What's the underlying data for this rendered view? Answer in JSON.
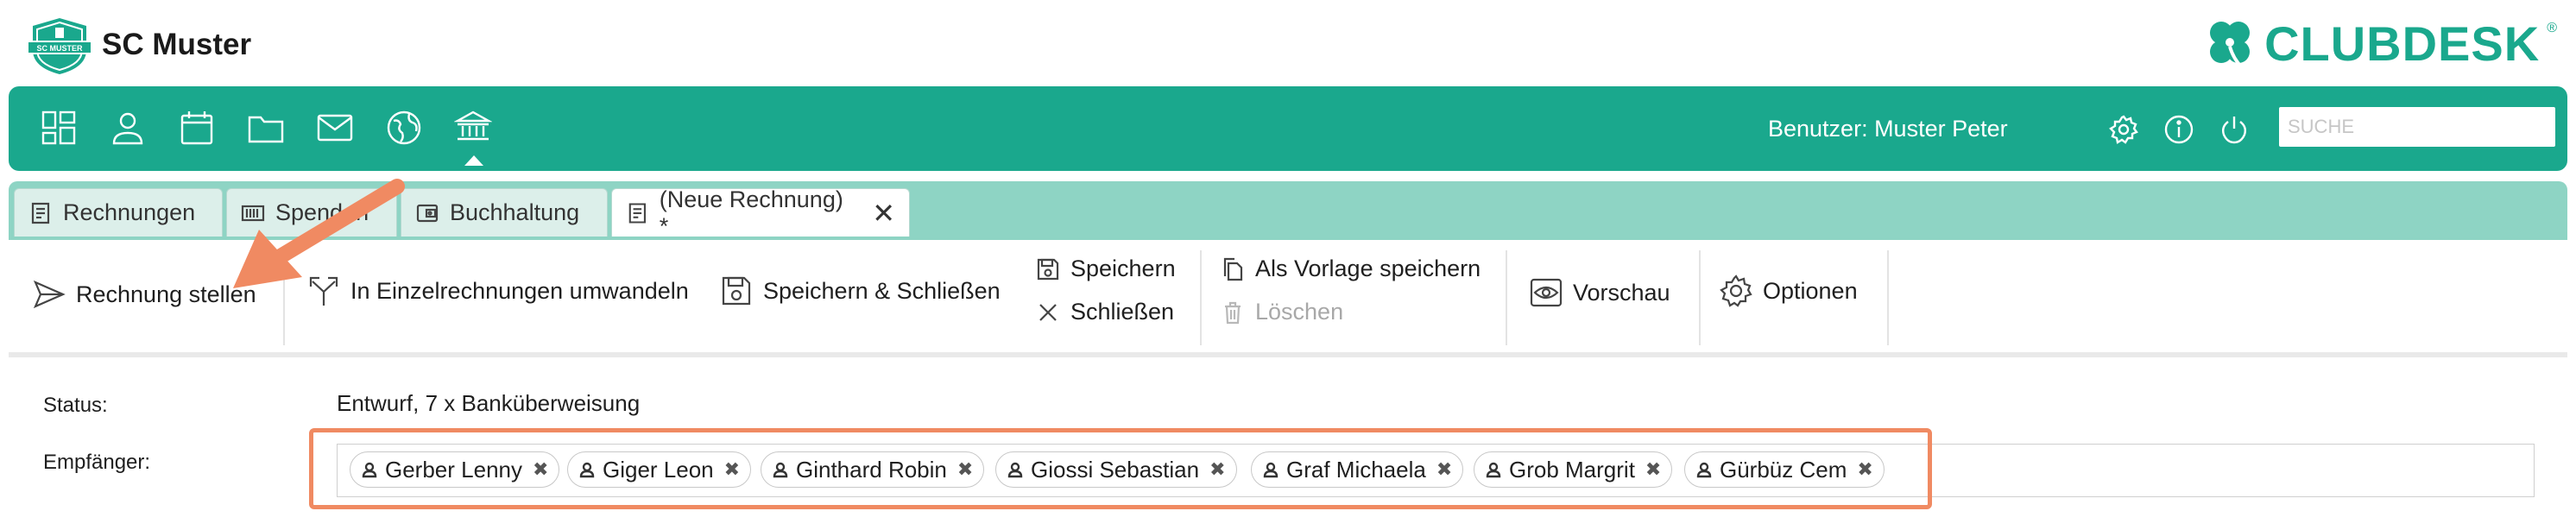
{
  "header": {
    "club_name": "SC Muster",
    "logo_text": "SC MUSTER",
    "brand_name": "CLUBDESK",
    "brand_reg": "®"
  },
  "navbar": {
    "icons": [
      "dashboard-icon",
      "person-icon",
      "calendar-icon",
      "folder-icon",
      "mail-icon",
      "globe-icon",
      "bank-icon"
    ],
    "user_label": "Benutzer: Muster Peter",
    "right_icons": [
      "gear-icon",
      "info-icon",
      "power-icon"
    ],
    "search_placeholder": "SUCHE"
  },
  "tabs": [
    {
      "label": "Rechnungen",
      "icon": "invoice-icon"
    },
    {
      "label": "Spenden",
      "icon": "barcode-icon"
    },
    {
      "label": "Buchhaltung",
      "icon": "wallet-icon"
    },
    {
      "label": "(Neue Rechnung) *",
      "icon": "invoice-icon",
      "active": true,
      "close": "✕"
    }
  ],
  "toolbar": {
    "send": "Rechnung stellen",
    "convert": "In Einzelrechnungen umwandeln",
    "save_close": "Speichern & Schließen",
    "save": "Speichern",
    "close": "Schließen",
    "save_template": "Als Vorlage speichern",
    "delete": "Löschen",
    "preview": "Vorschau",
    "options": "Optionen"
  },
  "form": {
    "status_label": "Status:",
    "status_value": "Entwurf, 7 x Banküberweisung",
    "recipients_label": "Empfänger:",
    "recipients": [
      "Gerber Lenny",
      "Giger Leon",
      "Ginthard Robin",
      "Giossi Sebastian",
      "Graf Michaela",
      "Grob Margrit",
      "Gürbüz Cem"
    ],
    "chip_remove": "✖"
  },
  "colors": {
    "brand_green": "#1aa88d",
    "tabbar_green": "#8ed4c4",
    "highlight_orange": "#f08a62"
  }
}
